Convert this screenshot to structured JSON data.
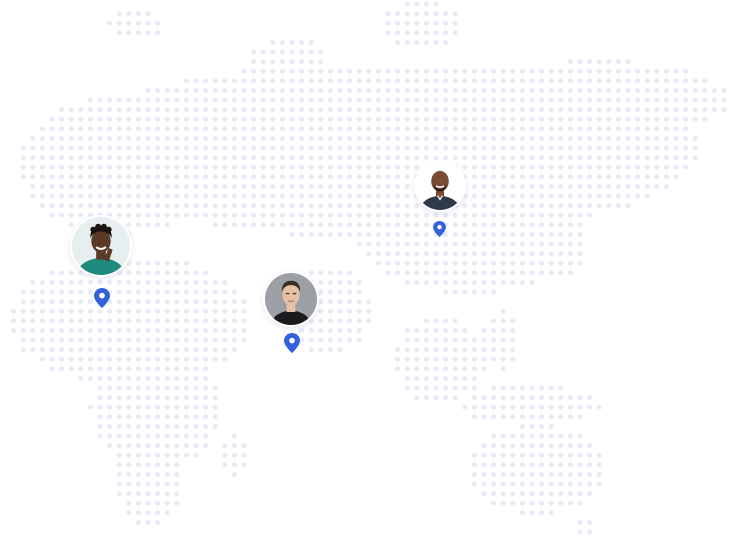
{
  "map": {
    "dot_color": "#e9ecf7",
    "pin_color": "#3460dc"
  },
  "users": [
    {
      "id": "user-west",
      "icon": "person-avatar",
      "background": "#e6eef0",
      "skin": "#5a3a26",
      "hair": "#1c1410",
      "shirt": "#1f8a7e"
    },
    {
      "id": "user-center",
      "icon": "person-avatar",
      "background": "#9c9fa6",
      "skin": "#e6c1a6",
      "hair": "#3b2d23",
      "shirt": "#1b1b1d"
    },
    {
      "id": "user-east",
      "icon": "person-avatar",
      "background": "#ffffff",
      "skin": "#7a4b32",
      "hair": "#7a4b32",
      "shirt": "#2e3a4c"
    }
  ]
}
